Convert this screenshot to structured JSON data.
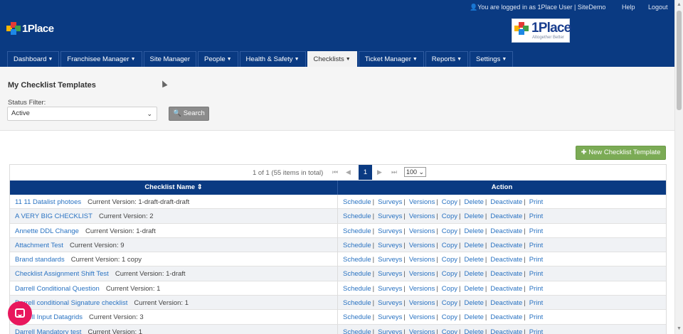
{
  "topbar": {
    "login_text": "You are logged in as  1Place User | SiteDemo",
    "help": "Help",
    "logout": "Logout"
  },
  "brand": {
    "logo_text": "1Place",
    "right_logo_text": "1Place",
    "right_logo_tagline": "Altogether Better",
    "colors": {
      "navy": "#0a3a82",
      "green": "#7bab55",
      "link": "#2a73c2"
    }
  },
  "nav": {
    "items": [
      {
        "label": "Dashboard",
        "dropdown": true
      },
      {
        "label": "Franchisee Manager",
        "dropdown": true
      },
      {
        "label": "Site Manager",
        "dropdown": false
      },
      {
        "label": "People",
        "dropdown": true
      },
      {
        "label": "Health & Safety",
        "dropdown": true
      },
      {
        "label": "Checklists",
        "dropdown": true,
        "active": true
      },
      {
        "label": "Ticket Manager",
        "dropdown": true
      },
      {
        "label": "Reports",
        "dropdown": true
      },
      {
        "label": "Settings",
        "dropdown": true
      }
    ]
  },
  "filter": {
    "page_title": "My Checklist Templates",
    "status_label": "Status Filter:",
    "status_value": "Active",
    "search_label": "Search"
  },
  "new_button_label": "New Checklist Template",
  "pager": {
    "info": "1 of 1 (55 items in total)",
    "current_page": "1",
    "page_size": "100"
  },
  "table": {
    "header_name": "Checklist Name",
    "header_action": "Action",
    "rows": [
      {
        "name": "11 11 Datalist photoes",
        "version": "Current Version: 1-draft-draft-draft"
      },
      {
        "name": "A VERY BIG CHECKLIST",
        "version": "Current Version: 2"
      },
      {
        "name": "Annette DDL Change",
        "version": "Current Version: 1-draft"
      },
      {
        "name": "Attachment Test",
        "version": "Current Version: 9"
      },
      {
        "name": "Brand standards",
        "version": "Current Version: 1 copy"
      },
      {
        "name": "Checklist Assignment Shift Test",
        "version": "Current Version: 1-draft"
      },
      {
        "name": "Darrell Conditional Question",
        "version": "Current Version: 1"
      },
      {
        "name": "Darrell conditional Signature checklist",
        "version": "Current Version: 1"
      },
      {
        "name": "Darrell Input Datagrids",
        "version": "Current Version: 3"
      },
      {
        "name": "Darrell Mandatory test",
        "version": "Current Version: 1"
      }
    ],
    "actions": [
      "Schedule",
      "Surveys",
      "Versions",
      "Copy",
      "Delete",
      "Deactivate",
      "Print"
    ]
  },
  "icons": {
    "user": "user-icon",
    "search": "search-icon",
    "plus": "plus-icon",
    "sort": "sort-icon",
    "chat": "chat-icon"
  }
}
